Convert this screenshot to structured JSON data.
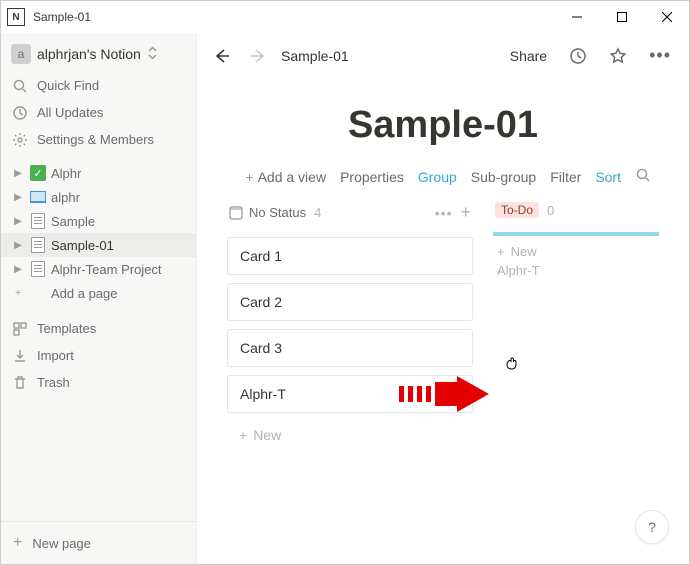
{
  "window": {
    "title": "Sample-01"
  },
  "sidebar": {
    "workspace": "alphrjan's Notion",
    "quick_find": "Quick Find",
    "all_updates": "All Updates",
    "settings": "Settings & Members",
    "pages": [
      {
        "name": "Alphr",
        "icon": "check"
      },
      {
        "name": "alphr",
        "icon": "laptop"
      },
      {
        "name": "Sample",
        "icon": "doc"
      },
      {
        "name": "Sample-01",
        "icon": "doc",
        "selected": true
      },
      {
        "name": "Alphr-Team Project",
        "icon": "doc"
      }
    ],
    "add_page": "Add a page",
    "templates": "Templates",
    "import": "Import",
    "trash": "Trash",
    "new_page": "New page"
  },
  "topbar": {
    "breadcrumb": "Sample-01",
    "share": "Share"
  },
  "page": {
    "title": "Sample-01",
    "add_view": "Add a view",
    "controls": {
      "properties": "Properties",
      "group": "Group",
      "subgroup": "Sub-group",
      "filter": "Filter",
      "sort": "Sort"
    },
    "columns": [
      {
        "key": "no_status",
        "label": "No Status",
        "count": "4",
        "cards": [
          "Card 1",
          "Card 2",
          "Card 3",
          "Alphr-T"
        ],
        "new_label": "New"
      },
      {
        "key": "to_do",
        "label": "To-Do",
        "count": "0",
        "ghost_new": "New",
        "ghost_card": "Alphr-T"
      }
    ]
  },
  "help": "?"
}
